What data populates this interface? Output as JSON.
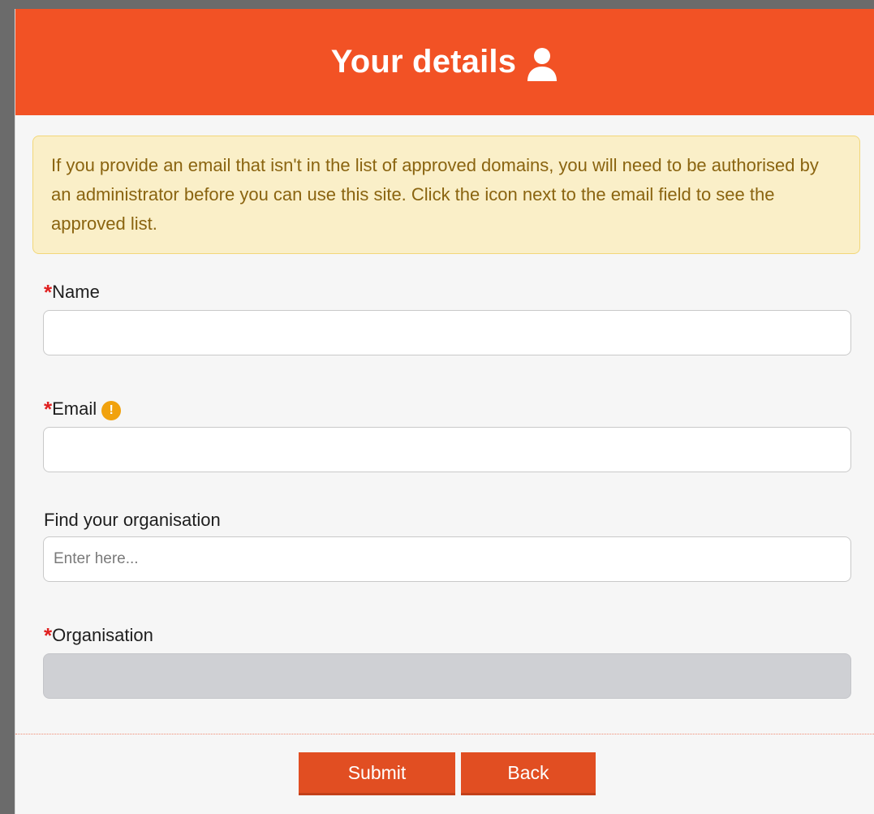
{
  "header": {
    "title": "Your details",
    "icon": "user-icon"
  },
  "alert": {
    "text": "If you provide an email that isn't in the list of approved domains, you will need to be authorised by an administrator before you can use this site. Click the icon next to the email field to see the approved list."
  },
  "fields": {
    "name": {
      "label": "Name",
      "required_marker": "*",
      "value": ""
    },
    "email": {
      "label": "Email",
      "required_marker": "*",
      "value": "",
      "info_icon": "!"
    },
    "find_org": {
      "label": "Find your organisation",
      "placeholder": "Enter here...",
      "value": ""
    },
    "organisation": {
      "label": "Organisation",
      "required_marker": "*",
      "value": ""
    }
  },
  "buttons": {
    "submit_label": "Submit",
    "back_label": "Back"
  },
  "colors": {
    "header_bg": "#f25225",
    "button_bg": "#e14e22",
    "alert_bg": "#faefc8",
    "alert_text": "#8a6410",
    "required": "#e02020",
    "info_icon": "#f1a20e"
  }
}
